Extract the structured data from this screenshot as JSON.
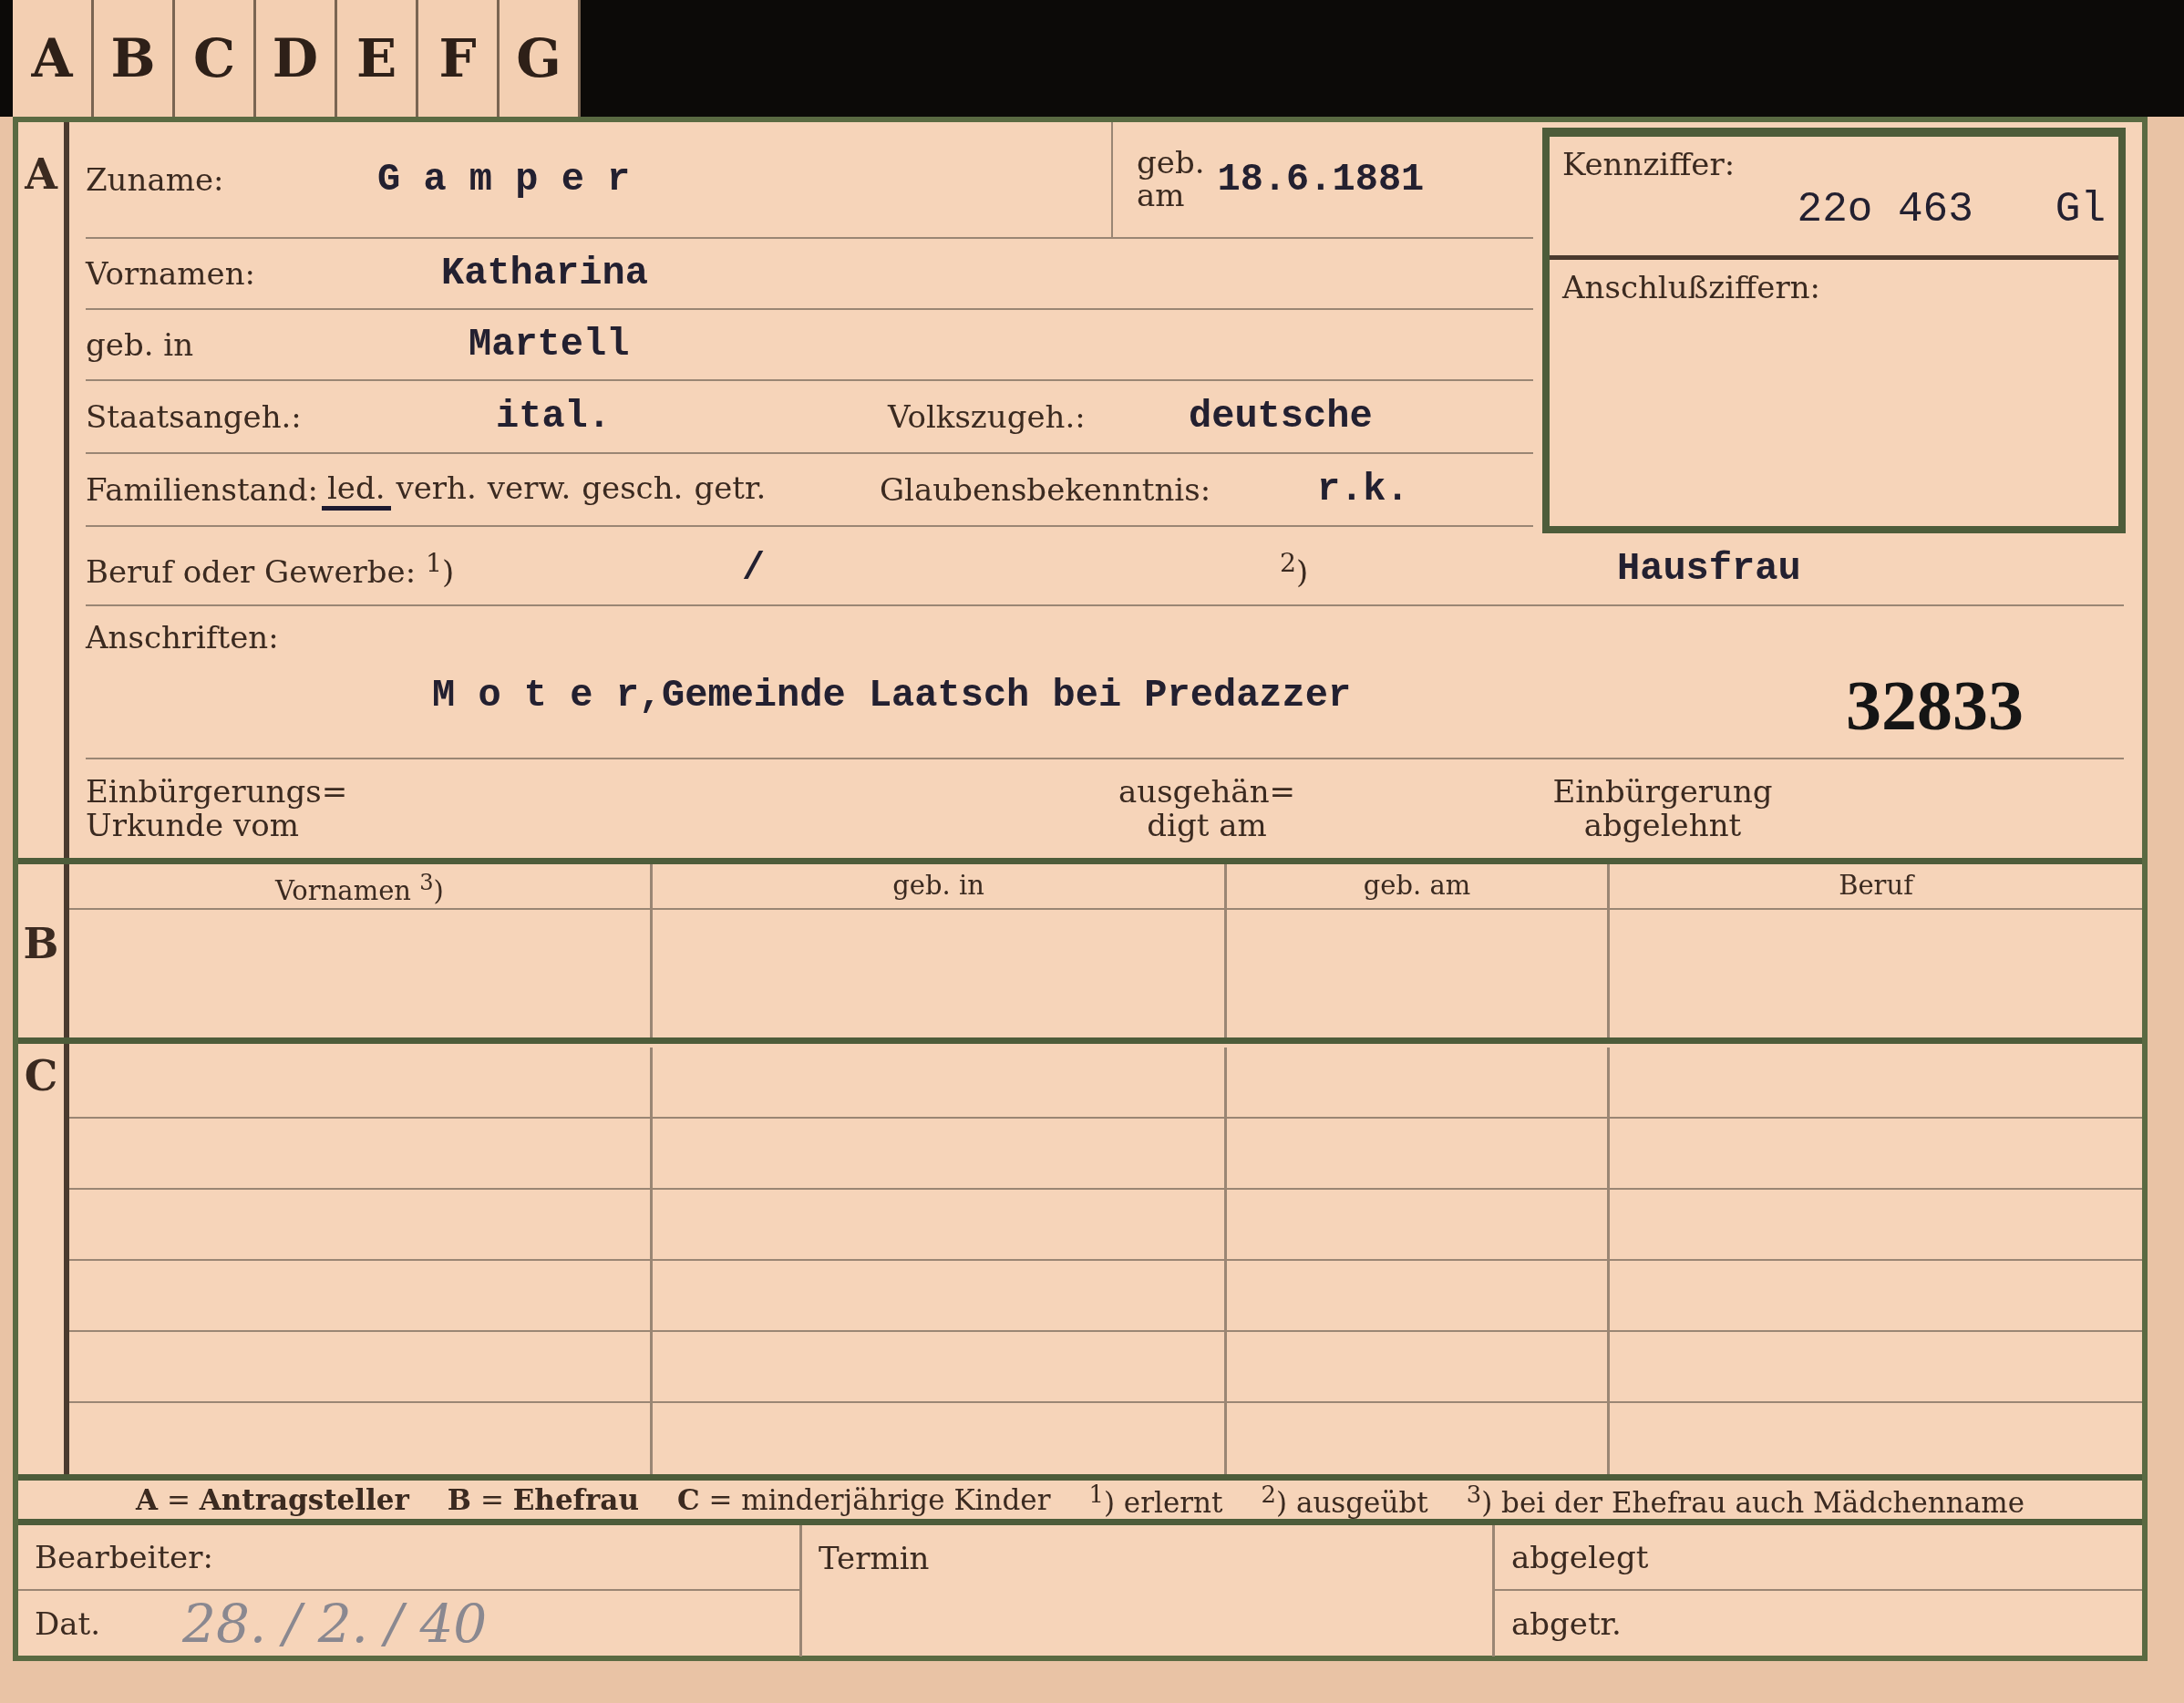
{
  "letter_tabs": [
    "A",
    "B",
    "C",
    "D",
    "E",
    "F",
    "G"
  ],
  "section_a": {
    "marker": "A",
    "surname": {
      "label": "Zuname:",
      "value": "G a m p e r"
    },
    "birth_date": {
      "label_1": "geb.",
      "label_2": "am",
      "value": "18.6.1881"
    },
    "given_names": {
      "label": "Vornamen:",
      "value": "Katharina"
    },
    "birthplace": {
      "label": "geb. in",
      "value": "Martell"
    },
    "citizenship": {
      "label": "Staatsangeh.:",
      "value": "ital."
    },
    "ethnicity": {
      "label": "Volkszugeh.:",
      "value": "deutsche"
    },
    "marital_status": {
      "label": "Familienstand:",
      "options": [
        {
          "label": "led.",
          "selected": true
        },
        {
          "label": "verh.",
          "selected": false
        },
        {
          "label": "verw.",
          "selected": false
        },
        {
          "label": "gesch.",
          "selected": false
        },
        {
          "label": "getr.",
          "selected": false
        }
      ]
    },
    "religion": {
      "label": "Glaubensbekenntnis:",
      "value": "r.k."
    },
    "id_box": {
      "label": "Kennziffer:",
      "value": "22o 463",
      "suffix": "Gl",
      "link_label": "Anschlußziffern:"
    },
    "occupation": {
      "label": "Beruf oder Gewerbe: $^{1}$)",
      "value_1": "/",
      "note_2": "$^{2}$)",
      "value_2": "Hausfrau"
    },
    "addresses": {
      "label": "Anschriften:",
      "value": "M o t e r,Gemeinde Laatsch bei Predazzer",
      "file_number": "32833"
    },
    "naturalization": [
      {
        "lines": [
          "Einbürgerungs=",
          "Urkunde vom"
        ]
      },
      {
        "lines": [
          "ausgehän=",
          "digt am"
        ]
      },
      {
        "lines": [
          "Einbürgerung",
          "abgelehnt"
        ]
      }
    ]
  },
  "section_b": {
    "marker": "B",
    "columns": [
      "Vornamen $^{3}$)",
      "geb. in",
      "geb. am",
      "Beruf"
    ]
  },
  "section_c": {
    "marker": "C"
  },
  "legend": [
    "**A** = **Antragsteller**",
    "**B** = **Ehefrau**",
    "**C** = minderjährige Kinder",
    "$^{1}$) erlernt",
    "$^{2}$) ausgeübt",
    "$^{3}$) bei der Ehefrau auch Mädchenname"
  ],
  "office": {
    "clerk_label": "Bearbeiter:",
    "date_label": "Dat.",
    "date_value": "28. / 2. / 40",
    "deadline_label": "Termin",
    "filed_label": "abgelegt",
    "transferred_label": "abgetr."
  }
}
